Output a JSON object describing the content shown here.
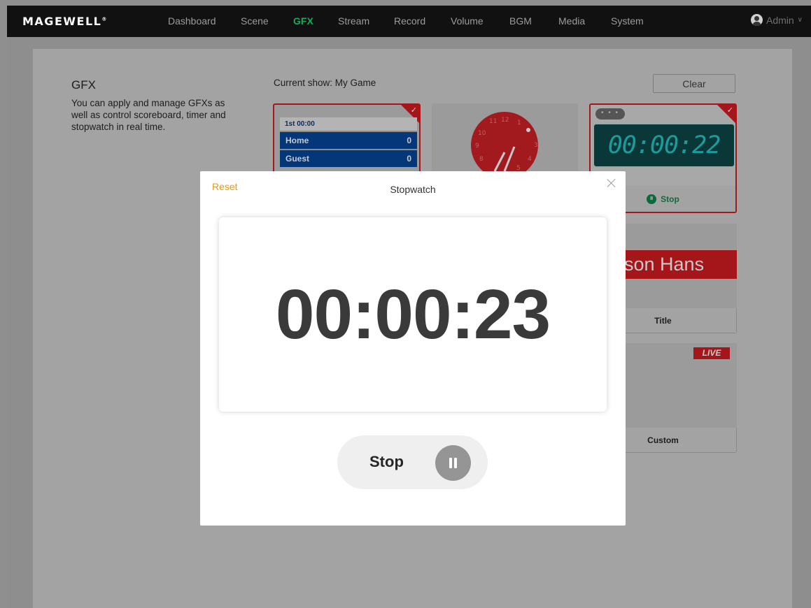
{
  "nav": {
    "logo": "MAGEWELL",
    "items": [
      "Dashboard",
      "Scene",
      "GFX",
      "Stream",
      "Record",
      "Volume",
      "BGM",
      "Media",
      "System"
    ],
    "active": "GFX",
    "user": "Admin"
  },
  "gfx": {
    "title": "GFX",
    "description": "You can apply and manage GFXs as well as control scoreboard, timer and stopwatch in real time.",
    "current_show": "Current show: My Game",
    "clear_label": "Clear"
  },
  "cards": {
    "scoreboard": {
      "period": "1st  00:00",
      "home": "Home",
      "home_score": "0",
      "guest": "Guest",
      "guest_score": "0"
    },
    "stopwatch": {
      "display": "00:00:22",
      "action": "Stop",
      "menu": "• • •"
    },
    "title": {
      "banner": "son Hans",
      "label": "Title"
    },
    "custom": {
      "badge": "LIVE",
      "label": "Custom"
    }
  },
  "modal": {
    "title": "Stopwatch",
    "reset": "Reset",
    "time": "00:00:23",
    "stop": "Stop"
  },
  "colors": {
    "accent_green": "#1aa85b",
    "reset_orange": "#f39800",
    "selected_red": "#a5161b"
  }
}
